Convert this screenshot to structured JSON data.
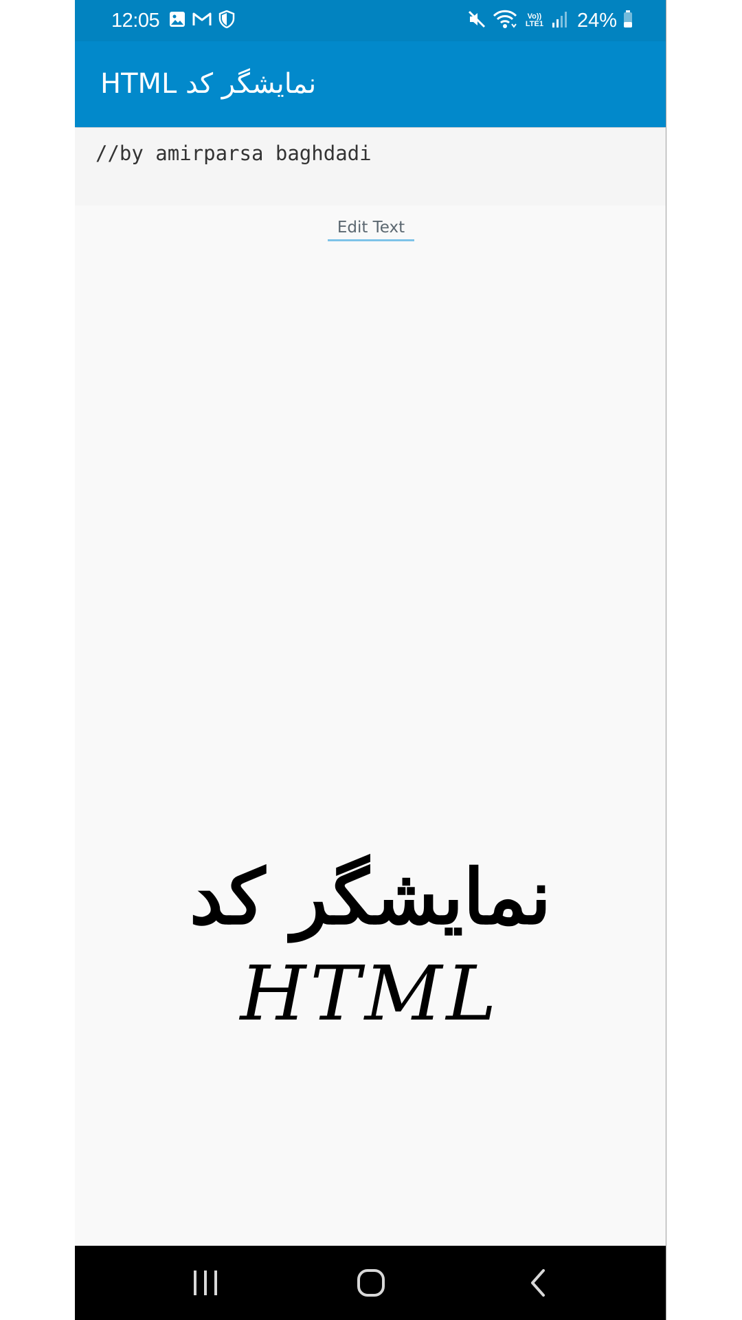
{
  "status_bar": {
    "time": "12:05",
    "battery": "24%",
    "network": "Vo)) LTE1",
    "icons": [
      "gallery-icon",
      "gmail-icon",
      "shield-icon",
      "mute-icon",
      "wifi-icon",
      "signal-icon",
      "battery-icon"
    ]
  },
  "app_bar": {
    "title": "نمایشگر کد HTML"
  },
  "editor": {
    "code": "//by amirparsa baghdadi"
  },
  "actions": {
    "edit_label": "Edit Text"
  },
  "render": {
    "line1": "نمایشگر کد",
    "line2": "HTML"
  },
  "nav_bar": {
    "buttons": [
      "recents-icon",
      "home-icon",
      "back-icon"
    ]
  },
  "colors": {
    "status_bar": "#0283c0",
    "app_bar": "#0289cb",
    "background": "#f9f9f9",
    "link_underline": "#7ec3e8"
  }
}
